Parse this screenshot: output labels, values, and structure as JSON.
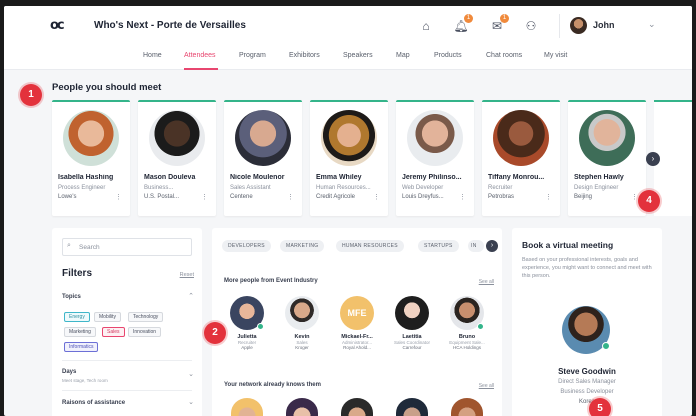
{
  "header": {
    "logo": "oc",
    "event_title": "Who's Next - Porte de Versailles",
    "user_name": "John",
    "message_badge": "1",
    "notification_badge": "1"
  },
  "nav": {
    "items": [
      "Home",
      "Attendees",
      "Program",
      "Exhibitors",
      "Speakers",
      "Map",
      "Products",
      "Chat rooms",
      "My visit"
    ],
    "active": "Attendees"
  },
  "steps": [
    "1",
    "2",
    "4",
    "5"
  ],
  "suggestions": {
    "title": "People you should meet",
    "people": [
      {
        "name": "Isabella Hashing",
        "role": "Process Engineer",
        "company": "Lowe's"
      },
      {
        "name": "Mason Douleva",
        "role": "Business...",
        "company": "U.S. Postal..."
      },
      {
        "name": "Nicole Moulenor",
        "role": "Sales Assistant",
        "company": "Centene"
      },
      {
        "name": "Emma Whiley",
        "role": "Human Resources...",
        "company": "Credit Agricole"
      },
      {
        "name": "Jeremy Philinso...",
        "role": "Web Developer",
        "company": "Louis Dreyfus..."
      },
      {
        "name": "Tiffany Monrou...",
        "role": "Recruiter",
        "company": "Petrobras"
      },
      {
        "name": "Stephen Hawly",
        "role": "Design Engineer",
        "company": "Beijing"
      }
    ]
  },
  "filters": {
    "search_placeholder": "Search",
    "title": "Filters",
    "reset": "Reset",
    "topics_label": "Topics",
    "topics": [
      "Energy",
      "Mobility",
      "Technology",
      "Marketing",
      "Sales",
      "Innovation",
      "Informatics"
    ],
    "days_label": "Days",
    "days_sub": "Meet stage, Tech room",
    "reasons_label": "Raisons of assistance"
  },
  "center": {
    "pills": [
      "DEVELOPERS",
      "MARKETING",
      "HUMAN RESOURCES",
      "STARTUPS",
      "IN"
    ],
    "industry_title": "More people from Event Industry",
    "see_all": "See all",
    "people": [
      {
        "name": "Julietta",
        "role": "Recruiter",
        "company": "Apple"
      },
      {
        "name": "Kevin",
        "role": "Sales",
        "company": "Kroger"
      },
      {
        "name": "Mickael-Fr...",
        "role": "Administrator...",
        "company": "Royal Ahold..."
      },
      {
        "name": "Laetitia",
        "role": "Sales Coordinator",
        "company": "Carrefour"
      },
      {
        "name": "Bruno",
        "role": "Equipment Sale...",
        "company": "HCA Holdings"
      }
    ],
    "avatar_initials": "MFE",
    "network_title": "Your network already knows them",
    "network_see_all": "See all"
  },
  "meeting": {
    "title": "Book a virtual meeting",
    "description": "Based on your professional interests, goals and experience, you might want to connect and meet with this person.",
    "name": "Steve Goodwin",
    "role": "Direct Sales Manager",
    "line2": "Business Developer",
    "company": "Korea"
  },
  "colors": {
    "accent": "#e8466f",
    "online": "#34b48a",
    "step": "#e3323c"
  }
}
